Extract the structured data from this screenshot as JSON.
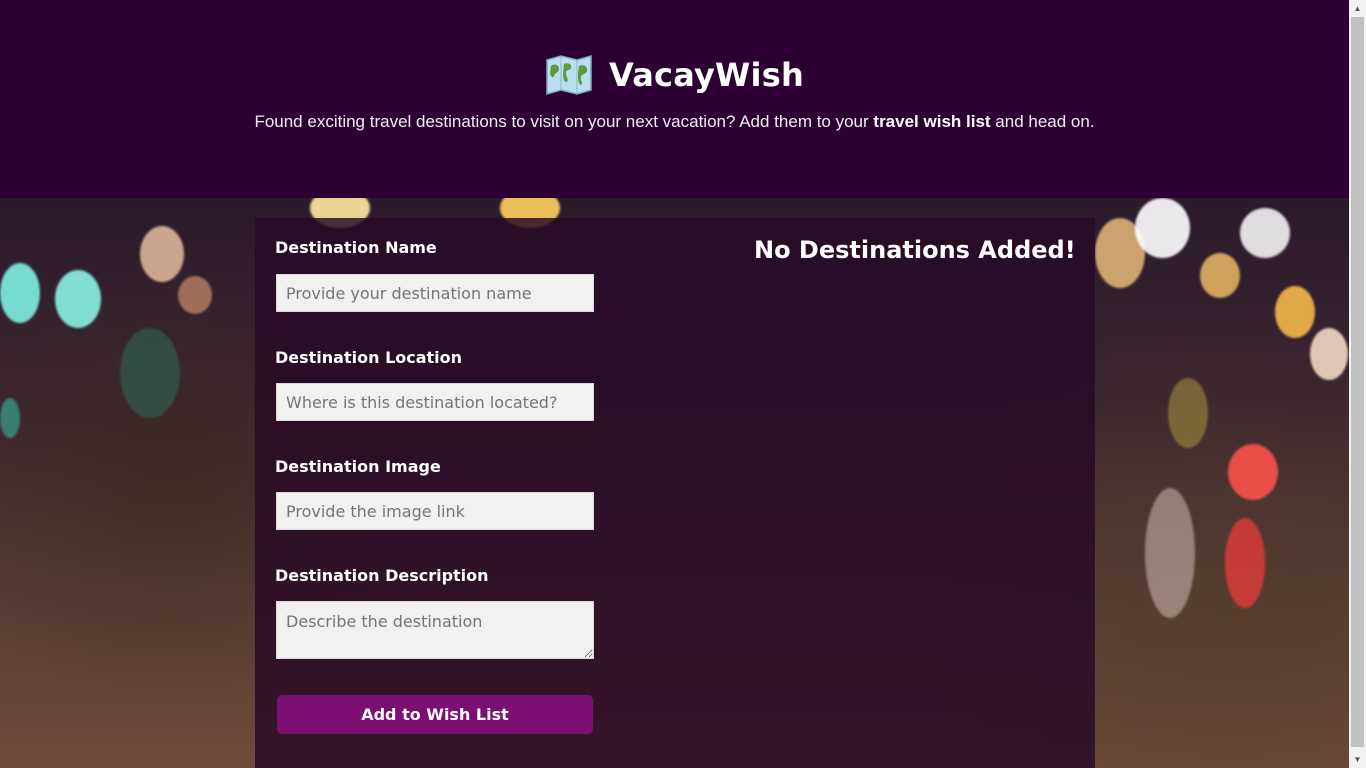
{
  "header": {
    "title": "VacayWish",
    "logo_icon": "world-map-icon",
    "tagline_before": "Found exciting travel destinations to visit on your next vacation? Add them to your ",
    "tagline_bold": "travel wish list",
    "tagline_after": " and head on."
  },
  "form": {
    "name_label": "Destination Name",
    "name_placeholder": "Provide your destination name",
    "location_label": "Destination Location",
    "location_placeholder": "Where is this destination located?",
    "image_label": "Destination Image",
    "image_placeholder": "Provide the image link",
    "description_label": "Destination Description",
    "description_placeholder": "Describe the destination",
    "submit_label": "Add to Wish List"
  },
  "wishlist": {
    "empty_message": "No Destinations Added!"
  },
  "colors": {
    "header_bg": "#2c0033",
    "button_bg": "#7d0f73",
    "panel_bg": "rgba(40,8,38,0.82)"
  }
}
